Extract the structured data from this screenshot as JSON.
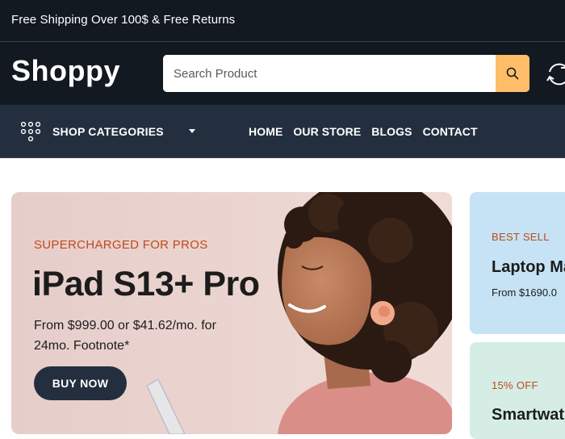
{
  "topbar": {
    "shipping_text": "Free Shipping Over 100$ & Free Returns"
  },
  "header": {
    "logo": "Shoppy",
    "search": {
      "placeholder": "Search Product",
      "value": ""
    },
    "icons": {
      "search": "search-icon",
      "refresh": "refresh-icon"
    }
  },
  "navbar": {
    "categories_label": "SHOP CATEGORIES",
    "categories_icon": "grid-dots-icon",
    "menu": [
      {
        "label": "HOME"
      },
      {
        "label": "OUR STORE"
      },
      {
        "label": "BLOGS"
      },
      {
        "label": "CONTACT"
      }
    ]
  },
  "hero": {
    "eyebrow": "SUPERCHARGED FOR PROS",
    "title": "iPad S13+ Pro",
    "description": "From $999.00 or $41.62/mo. for 24mo. Footnote*",
    "button_label": "BUY NOW"
  },
  "side_cards": [
    {
      "eyebrow": "BEST SELL",
      "title": "Laptop Ma",
      "price": "From $1690.0"
    },
    {
      "eyebrow": "15% OFF",
      "title": "Smartwat"
    }
  ],
  "colors": {
    "header_bg": "#131921",
    "nav_bg": "#232f3e",
    "accent": "#febd69",
    "eyebrow": "#bd4a1c"
  }
}
